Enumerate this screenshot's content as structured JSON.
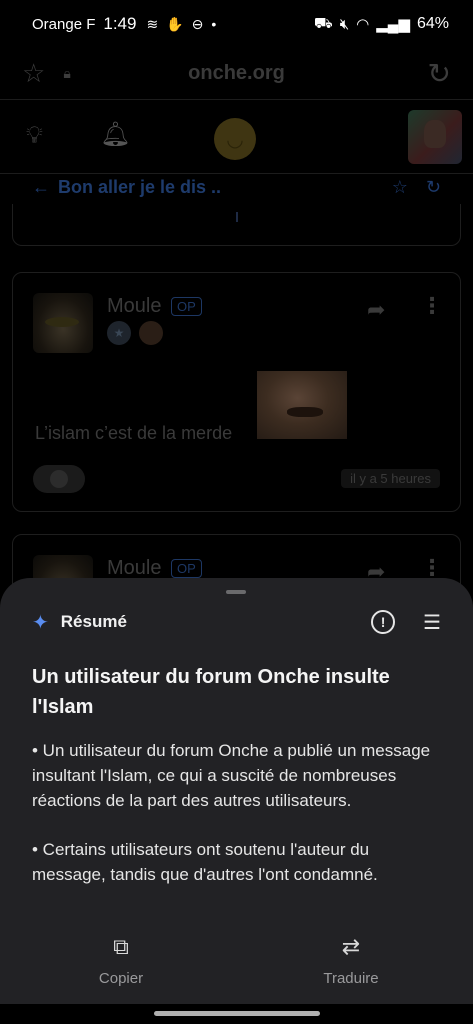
{
  "status_bar": {
    "carrier": "Orange F",
    "time": "1:49",
    "battery": "64%",
    "left_icons": [
      "signal-wave-icon",
      "hand-icon",
      "dnd-icon",
      "dot-icon"
    ],
    "right_icons": [
      "bed-icon",
      "mute-icon",
      "wifi-icon",
      "signal-bars-icon"
    ]
  },
  "browser": {
    "url": "onche.org"
  },
  "topic": {
    "title": "Bon aller je le dis .."
  },
  "post": {
    "author": "Moule",
    "op_badge": "OP",
    "message": "L’islam c’est de la merde",
    "time": "il y a 5 heures"
  },
  "post2": {
    "author": "Moule",
    "op_badge": "OP"
  },
  "summary": {
    "label": "Résumé",
    "title": "Un utilisateur du forum Onche insulte l'Islam",
    "bullets": [
      "• Un utilisateur du forum Onche a publié un message insultant l'Islam, ce qui a suscité de nombreuses réactions de la part des autres utilisateurs.",
      "• Certains utilisateurs ont soutenu l'auteur du message, tandis que d'autres l'ont condamné."
    ],
    "copy_label": "Copier",
    "translate_label": "Traduire"
  },
  "colors": {
    "accent": "#5a8df0",
    "sheet_bg": "#222225",
    "link_dim": "#1e3b6c"
  }
}
